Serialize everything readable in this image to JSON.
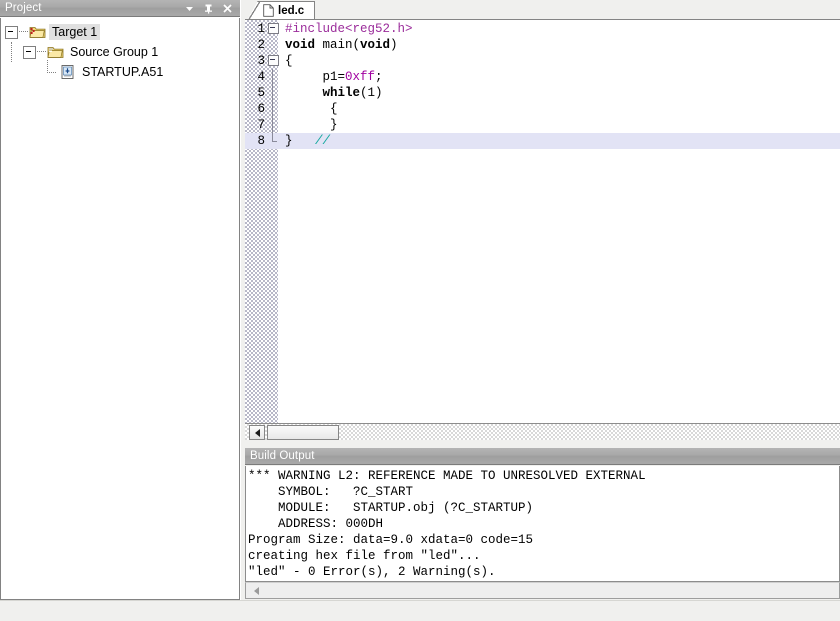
{
  "project_panel": {
    "title": "Project",
    "buttons": [
      {
        "name": "panel-menu-button",
        "icon": "chevron-down-icon"
      },
      {
        "name": "panel-pin-button",
        "icon": "pin-icon"
      },
      {
        "name": "panel-close-button",
        "icon": "close-icon"
      }
    ],
    "tree": [
      {
        "label": "Target 1",
        "level": 0,
        "icon": "target-folder-icon",
        "expanded": true,
        "selected": true
      },
      {
        "label": "Source Group 1",
        "level": 1,
        "icon": "source-group-folder-icon",
        "expanded": true,
        "selected": false
      },
      {
        "label": "STARTUP.A51",
        "level": 2,
        "icon": "asm-file-icon",
        "expanded": null,
        "selected": false
      }
    ]
  },
  "editor": {
    "tabs": [
      {
        "label": "led.c",
        "icon": "c-file-icon",
        "active": true
      }
    ],
    "code_lines": [
      {
        "num": "1",
        "fold": "box",
        "segments": [
          {
            "text": "#include<reg52.h>",
            "style": "pre"
          }
        ]
      },
      {
        "num": "2",
        "fold": "none",
        "segments": [
          {
            "text": "void",
            "style": "kw"
          },
          {
            "text": " main(",
            "style": "plain"
          },
          {
            "text": "void",
            "style": "kw"
          },
          {
            "text": ")",
            "style": "plain"
          }
        ]
      },
      {
        "num": "3",
        "fold": "box",
        "segments": [
          {
            "text": "{",
            "style": "plain"
          }
        ]
      },
      {
        "num": "4",
        "fold": "stem",
        "segments": [
          {
            "text": "     p1=",
            "style": "plain"
          },
          {
            "text": "0xff",
            "style": "num"
          },
          {
            "text": ";",
            "style": "plain"
          }
        ]
      },
      {
        "num": "5",
        "fold": "stem",
        "segments": [
          {
            "text": "     ",
            "style": "plain"
          },
          {
            "text": "while",
            "style": "kw"
          },
          {
            "text": "(1)",
            "style": "plain"
          }
        ]
      },
      {
        "num": "6",
        "fold": "stem",
        "segments": [
          {
            "text": "      {",
            "style": "plain"
          }
        ]
      },
      {
        "num": "7",
        "fold": "stem",
        "segments": [
          {
            "text": "      }",
            "style": "plain"
          }
        ]
      },
      {
        "num": "8",
        "fold": "end",
        "current": true,
        "segments": [
          {
            "text": "}   ",
            "style": "plain"
          },
          {
            "text": "//",
            "style": "cmt"
          }
        ]
      }
    ],
    "hscrollbar": {
      "left_button": "scroll-left-arrow",
      "thumb_present": true
    }
  },
  "build_output": {
    "title": "Build Output",
    "lines": [
      "*** WARNING L2: REFERENCE MADE TO UNRESOLVED EXTERNAL",
      "    SYMBOL:   ?C_START",
      "    MODULE:   STARTUP.obj (?C_STARTUP)",
      "    ADDRESS: 000DH",
      "Program Size: data=9.0 xdata=0 code=15",
      "creating hex file from \"led\"...",
      "\"led\" - 0 Error(s), 2 Warning(s)."
    ],
    "hscrollbar": {
      "left_button": "scroll-left-arrow",
      "disabled": true
    }
  },
  "colors": {
    "titlebar": "#a8a8a8",
    "titlebar_text": "#ffffff",
    "preprocessor": "#9b2d9b",
    "number_literal": "#a000a0",
    "comment": "#13a89e",
    "current_line": "#e2e3f5",
    "selection": "#e0e0e0",
    "window_bg": "#f0f0ee"
  }
}
